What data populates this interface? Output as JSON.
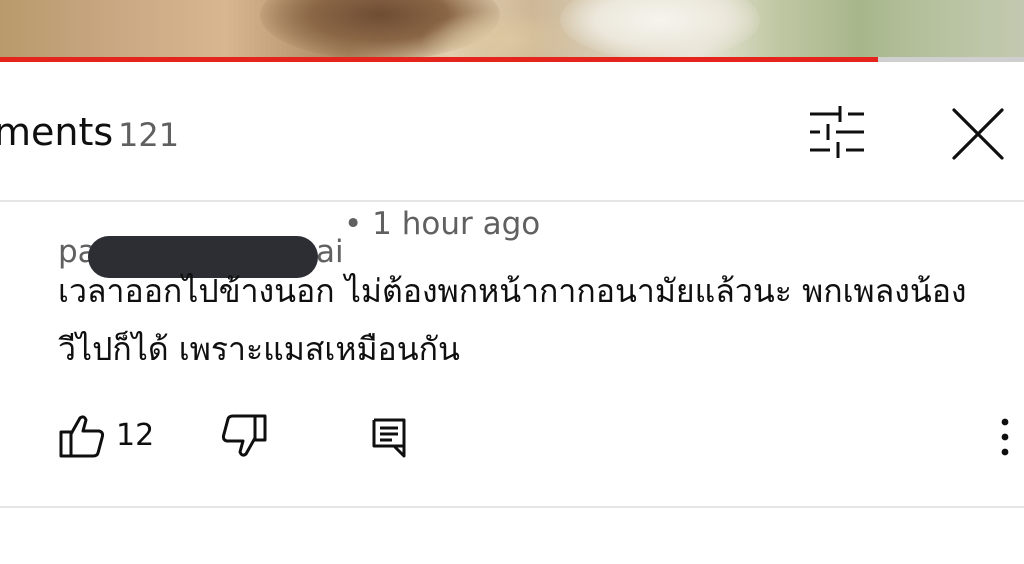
{
  "player": {
    "progress_fraction": 0.857,
    "accent_color": "#e5251d"
  },
  "header": {
    "title": "Comments",
    "title_visible": "ments",
    "count": "121",
    "filter_icon": "sliders-icon",
    "close_icon": "close-icon"
  },
  "comment": {
    "author_visible_start": "pa",
    "author_visible_end": "ai",
    "separator": "•",
    "time": "1 hour ago",
    "body": "เวลาออกไปข้างนอก ไม่ต้องพกหน้ากากอนามัยแล้วนะ พกเพลงน้องวีไปก็ได้ เพราะแมสเหมือนกัน",
    "body_line1": "เวลาออกไปข้างนอก ไม่ต้องพกหน้ากากอนามัยแล้วนะ พกเพลงน้อง",
    "body_line2": "วีไปก็ได้ เพราะแมสเหมือนกัน",
    "likes": "12",
    "icons": {
      "like": "thumbs-up-icon",
      "dislike": "thumbs-down-icon",
      "reply": "reply-icon",
      "more": "more-vertical-icon"
    }
  }
}
